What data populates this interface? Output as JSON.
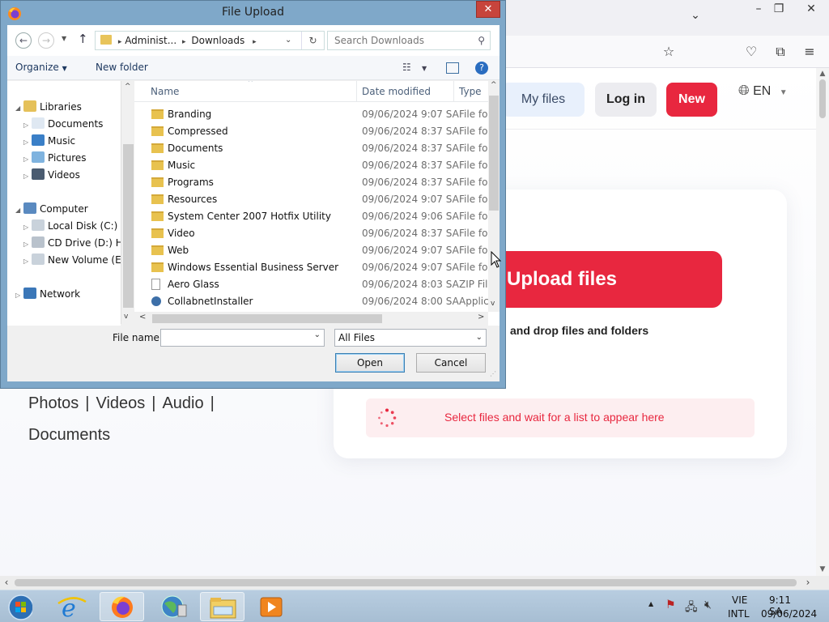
{
  "dialog": {
    "title": "File Upload",
    "address": {
      "segments": [
        "Administ...",
        "Downloads"
      ]
    },
    "search_placeholder": "Search Downloads",
    "toolbar": {
      "organize": "Organize",
      "new_folder": "New folder"
    },
    "tree": [
      {
        "label": "Libraries",
        "icon": "libraries-icon",
        "level": 0,
        "expanded": true
      },
      {
        "label": "Documents",
        "icon": "documents-icon",
        "level": 1
      },
      {
        "label": "Music",
        "icon": "music-icon",
        "level": 1
      },
      {
        "label": "Pictures",
        "icon": "pictures-icon",
        "level": 1
      },
      {
        "label": "Videos",
        "icon": "videos-icon",
        "level": 1
      },
      {
        "label": "Computer",
        "icon": "computer-icon",
        "level": 0,
        "expanded": true
      },
      {
        "label": "Local Disk (C:)",
        "icon": "drive-icon",
        "level": 1
      },
      {
        "label": "CD Drive (D:) HB",
        "icon": "cd-drive-icon",
        "level": 1
      },
      {
        "label": "New Volume (E:)",
        "icon": "drive-icon",
        "level": 1
      },
      {
        "label": "Network",
        "icon": "network-icon",
        "level": 0
      }
    ],
    "columns": {
      "name": "Name",
      "date": "Date modified",
      "type": "Type"
    },
    "files": [
      {
        "name": "Branding",
        "date": "09/06/2024 9:07 SA",
        "type": "File fol",
        "kind": "folder"
      },
      {
        "name": "Compressed",
        "date": "09/06/2024 8:37 SA",
        "type": "File fol",
        "kind": "folder"
      },
      {
        "name": "Documents",
        "date": "09/06/2024 8:37 SA",
        "type": "File fol",
        "kind": "folder"
      },
      {
        "name": "Music",
        "date": "09/06/2024 8:37 SA",
        "type": "File fol",
        "kind": "folder"
      },
      {
        "name": "Programs",
        "date": "09/06/2024 8:37 SA",
        "type": "File fol",
        "kind": "folder"
      },
      {
        "name": "Resources",
        "date": "09/06/2024 9:07 SA",
        "type": "File fol",
        "kind": "folder"
      },
      {
        "name": "System Center 2007 Hotfix Utility",
        "date": "09/06/2024 9:06 SA",
        "type": "File fol",
        "kind": "folder"
      },
      {
        "name": "Video",
        "date": "09/06/2024 8:37 SA",
        "type": "File fol",
        "kind": "folder"
      },
      {
        "name": "Web",
        "date": "09/06/2024 9:07 SA",
        "type": "File fol",
        "kind": "folder"
      },
      {
        "name": "Windows Essential Business Server",
        "date": "09/06/2024 9:07 SA",
        "type": "File fol",
        "kind": "folder"
      },
      {
        "name": "Aero Glass",
        "date": "09/06/2024 8:03 SA",
        "type": "ZIP File",
        "kind": "zip"
      },
      {
        "name": "CollabnetInstaller",
        "date": "09/06/2024 8:00 SA",
        "type": "Applic",
        "kind": "app"
      }
    ],
    "file_name_label": "File name:",
    "file_name_value": "",
    "file_type_selected": "All Files",
    "open_label": "Open",
    "cancel_label": "Cancel"
  },
  "site": {
    "my_files": "My files",
    "log_in": "Log in",
    "new": "New",
    "lang": "EN",
    "upload_files": "Upload files",
    "drop_text": "and drop files and folders",
    "status_text": "Select files and wait for a list to appear here",
    "file_types": [
      "Photos",
      "Videos",
      "Audio",
      "Documents"
    ],
    "accent_color": "#e8273f"
  },
  "taskbar": {
    "apps": [
      "start-orb-icon",
      "internet-explorer-icon",
      "firefox-icon",
      "network-globe-icon",
      "file-explorer-icon",
      "media-player-icon"
    ],
    "lang": "VIE",
    "layout": "INTL",
    "time": "9:11 SA",
    "date": "09/06/2024"
  }
}
